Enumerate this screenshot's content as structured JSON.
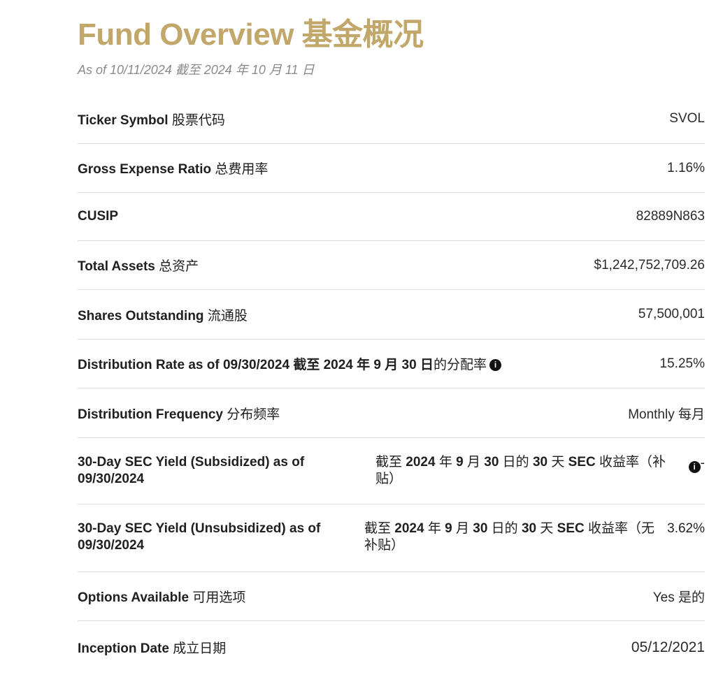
{
  "header": {
    "title": "Fund Overview 基金概况",
    "as_of": "As of 10/11/2024 截至 2024 年 10 月 11 日"
  },
  "rows": [
    {
      "label": "Ticker Symbol",
      "label_cn": "股票代码",
      "value": "SVOL"
    },
    {
      "label": "Gross Expense Ratio",
      "label_cn": "总费用率",
      "value": "1.16%"
    },
    {
      "label": "CUSIP",
      "label_cn": "",
      "value": "82889N863"
    },
    {
      "label": "Total Assets",
      "label_cn": "总资产",
      "value": "$1,242,752,709.26"
    },
    {
      "label": "Shares Outstanding",
      "label_cn": "流通股",
      "value": "57,500,001"
    },
    {
      "label": "Distribution Rate as of 09/30/2024 截至 2024 年 9 月 30 日",
      "label_cn": "的分配率",
      "value": "15.25%"
    },
    {
      "label": "Distribution Frequency",
      "label_cn": "分布频率",
      "value": "Monthly 每月"
    },
    {
      "label": "30-Day SEC Yield (Subsidized) as of 09/30/2024",
      "label_cn_pre": "截至 ",
      "label_cn_b1": "2024",
      "label_cn_mid1": " 年 ",
      "label_cn_b2": "9",
      "label_cn_mid2": " 月 ",
      "label_cn_b3": "30",
      "label_cn_mid3": " 日的 ",
      "label_cn_b4": "30",
      "label_cn_mid4": " 天 ",
      "label_cn_b5": "SEC",
      "label_cn_post": " 收益率（补贴）",
      "value": "-"
    },
    {
      "label": "30-Day SEC Yield (Unsubsidized) as of 09/30/2024",
      "label_cn_pre": "截至 ",
      "label_cn_b1": "2024",
      "label_cn_mid1": " 年 ",
      "label_cn_b2": "9",
      "label_cn_mid2": " 月 ",
      "label_cn_b3": "30",
      "label_cn_mid3": " 日的 ",
      "label_cn_b4": "30",
      "label_cn_mid4": " 天 ",
      "label_cn_b5": "SEC",
      "label_cn_post": " 收益率（无补贴）",
      "value": "3.62%"
    },
    {
      "label": "Options Available",
      "label_cn": "可用选项",
      "value": "Yes 是的"
    },
    {
      "label": "Inception Date",
      "label_cn": "成立日期",
      "value": "05/12/2021"
    }
  ],
  "info_icon": {
    "glyph": "i",
    "name": "info-icon"
  }
}
